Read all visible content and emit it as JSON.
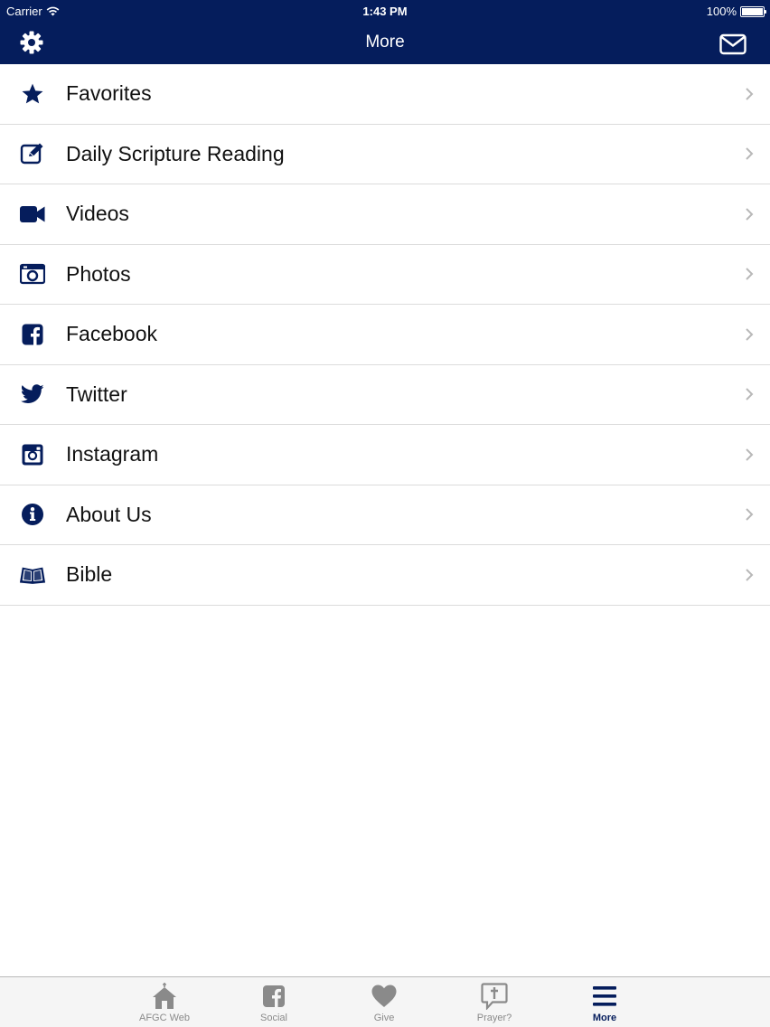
{
  "status": {
    "carrier": "Carrier",
    "time": "1:43 PM",
    "battery": "100%"
  },
  "nav": {
    "title": "More",
    "left_icon": "gear-icon",
    "right_icon": "mail-icon"
  },
  "items": [
    {
      "label": "Favorites",
      "icon": "star-icon"
    },
    {
      "label": "Daily Scripture Reading",
      "icon": "edit-icon"
    },
    {
      "label": "Videos",
      "icon": "video-camera-icon"
    },
    {
      "label": "Photos",
      "icon": "camera-icon"
    },
    {
      "label": "Facebook",
      "icon": "facebook-icon"
    },
    {
      "label": "Twitter",
      "icon": "twitter-icon"
    },
    {
      "label": "Instagram",
      "icon": "instagram-icon"
    },
    {
      "label": "About Us",
      "icon": "info-icon"
    },
    {
      "label": "Bible",
      "icon": "book-icon"
    }
  ],
  "tabs": [
    {
      "label": "AFGC Web",
      "icon": "church-icon",
      "active": false
    },
    {
      "label": "Social",
      "icon": "facebook-icon",
      "active": false
    },
    {
      "label": "Give",
      "icon": "heart-icon",
      "active": false
    },
    {
      "label": "Prayer?",
      "icon": "prayer-bubble-icon",
      "active": false
    },
    {
      "label": "More",
      "icon": "menu-icon",
      "active": true
    }
  ],
  "colors": {
    "brand_navy": "#051d5c",
    "tab_inactive": "#8a8a8a",
    "separator": "#dcdcdc"
  }
}
